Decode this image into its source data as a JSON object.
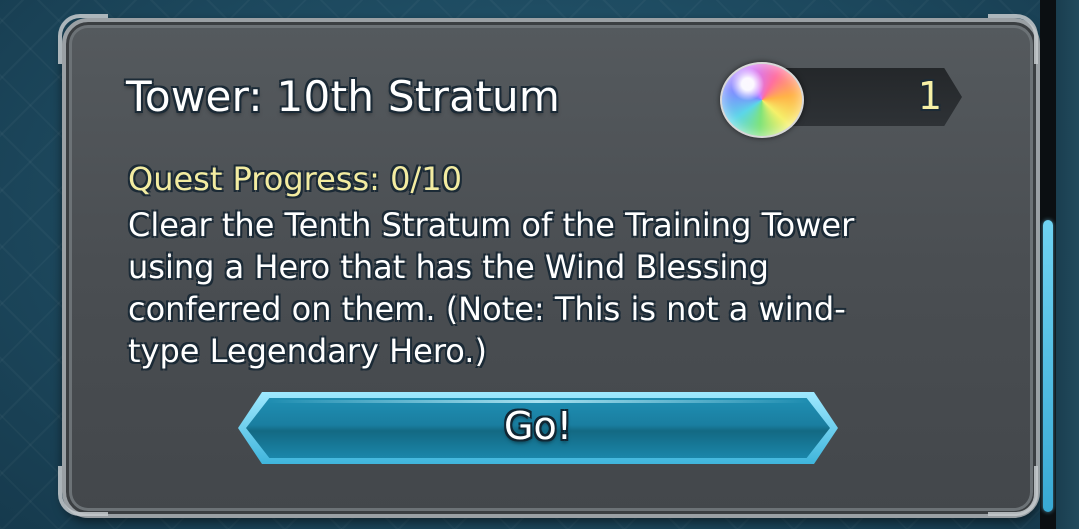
{
  "quest": {
    "title": "Tower: 10th Stratum",
    "reward_icon": "orb-icon",
    "reward_count": "1",
    "progress": "Quest Progress: 0/10",
    "description_lines": [
      "Clear the Tenth Stratum of the Training Tower",
      "using a Hero that has the Wind Blessing",
      "conferred on them. (Note: This is not a wind-",
      "type Legendary Hero.)"
    ],
    "go_label": "Go!"
  },
  "colors": {
    "panel": "#4a4e52",
    "accent_text": "#f3eca1",
    "button": "#1a7ea0",
    "scroll_thumb": "#38a9d4"
  }
}
